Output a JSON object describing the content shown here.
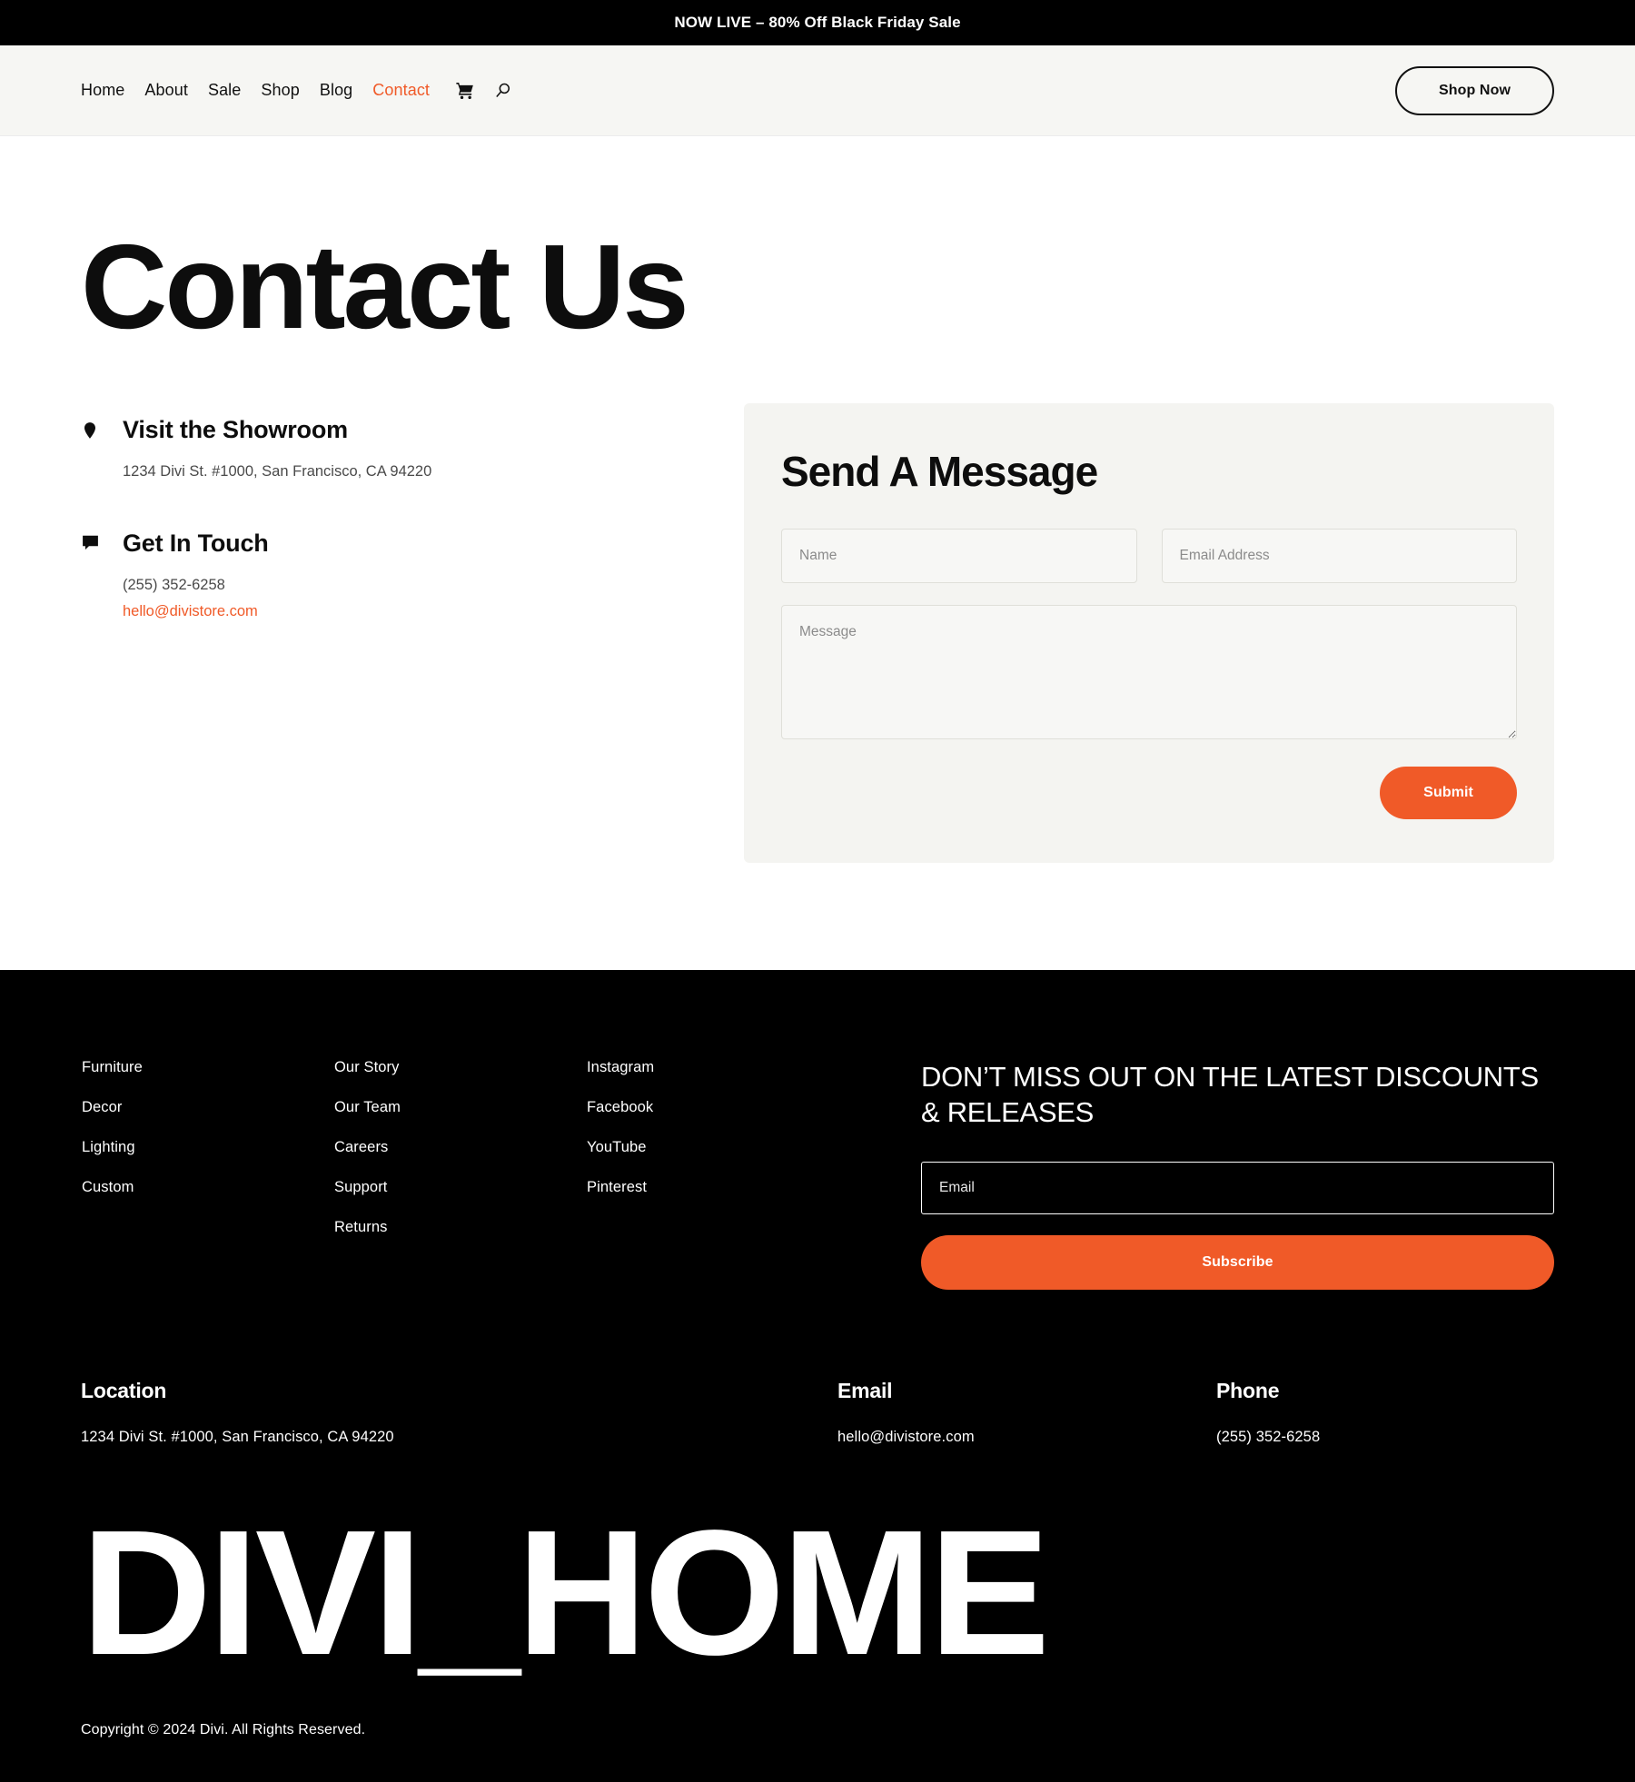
{
  "announcement": {
    "text": "NOW LIVE – 80% Off Black Friday Sale",
    "background": "#000000",
    "color": "#ffffff"
  },
  "header": {
    "nav_items": [
      {
        "label": "Home",
        "active": false
      },
      {
        "label": "About",
        "active": false
      },
      {
        "label": "Sale",
        "active": false
      },
      {
        "label": "Shop",
        "active": false
      },
      {
        "label": "Blog",
        "active": false
      },
      {
        "label": "Contact",
        "active": true
      }
    ],
    "icons": [
      "cart-icon",
      "search-icon"
    ],
    "cta_label": "Shop Now",
    "active_color": "#f05a28",
    "background": "#f6f6f3"
  },
  "hero": {
    "title": "Contact Us"
  },
  "contact_info": [
    {
      "icon": "map-pin-icon",
      "heading": "Visit the Showroom",
      "lines": [
        {
          "text": "1234 Divi St. #1000, San Francisco, CA 94220",
          "link": false
        }
      ]
    },
    {
      "icon": "chat-bubble-icon",
      "heading": "Get In Touch",
      "lines": [
        {
          "text": "(255) 352-6258",
          "link": false
        },
        {
          "text": "hello@divistore.com",
          "link": true
        }
      ]
    }
  ],
  "form": {
    "title": "Send A Message",
    "name_placeholder": "Name",
    "name_value": "",
    "email_placeholder": "Email Address",
    "email_value": "",
    "message_placeholder": "Message",
    "message_value": "",
    "submit_label": "Submit",
    "accent_color": "#f05a28",
    "card_background": "#f4f4f1"
  },
  "footer": {
    "columns": [
      {
        "links": [
          "Furniture",
          "Decor",
          "Lighting",
          "Custom"
        ]
      },
      {
        "links": [
          "Our Story",
          "Our Team",
          "Careers",
          "Support",
          "Returns"
        ]
      },
      {
        "links": [
          "Instagram",
          "Facebook",
          "YouTube",
          "Pinterest"
        ]
      }
    ],
    "newsletter": {
      "title": "DON’T MISS OUT ON THE LATEST DISCOUNTS & RELEASES",
      "email_placeholder": "Email",
      "email_value": "",
      "subscribe_label": "Subscribe"
    },
    "contact": {
      "location_heading": "Location",
      "location_value": "1234 Divi St. #1000, San Francisco, CA 94220",
      "email_heading": "Email",
      "email_value": "hello@divistore.com",
      "phone_heading": "Phone",
      "phone_value": "(255) 352-6258"
    },
    "wordmark": "DIVI_HOME",
    "copyright": "Copyright © 2024 Divi. All Rights Reserved.",
    "background": "#000000"
  }
}
